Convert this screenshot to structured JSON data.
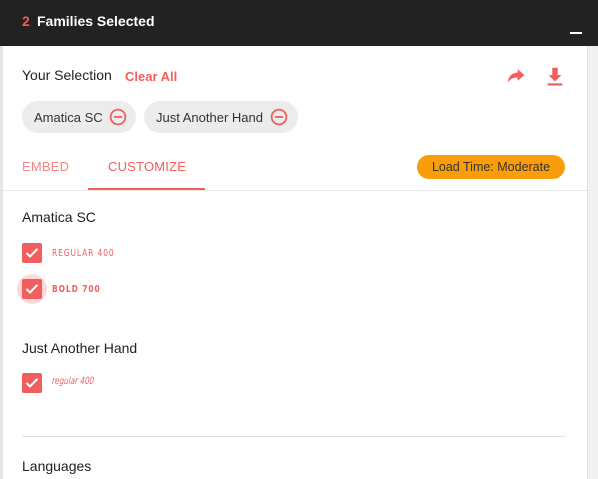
{
  "header": {
    "count": "2",
    "title": "Families Selected",
    "minimize_icon": "minimize-icon"
  },
  "selection": {
    "label": "Your Selection",
    "clear_all": "Clear All",
    "share_icon": "share-arrow-icon",
    "download_icon": "download-icon",
    "chips": [
      {
        "label": "Amatica SC",
        "remove_icon": "remove-circle-icon"
      },
      {
        "label": "Just Another Hand",
        "remove_icon": "remove-circle-icon"
      }
    ]
  },
  "tabs": [
    {
      "label": "EMBED",
      "active": false
    },
    {
      "label": "CUSTOMIZE",
      "active": true
    }
  ],
  "load_time": "Load Time: Moderate",
  "families": [
    {
      "name": "Amatica SC",
      "styles": [
        {
          "label": "REGULAR 400",
          "checked": true
        },
        {
          "label": "BOLD 700",
          "checked": true
        }
      ]
    },
    {
      "name": "Just Another Hand",
      "styles": [
        {
          "label": "regular 400",
          "checked": true
        }
      ]
    }
  ],
  "languages_label": "Languages",
  "colors": {
    "accent": "#f25d5d",
    "header_bg": "#222222",
    "badge_bg": "#f99e0a",
    "chip_bg": "#ececec"
  }
}
